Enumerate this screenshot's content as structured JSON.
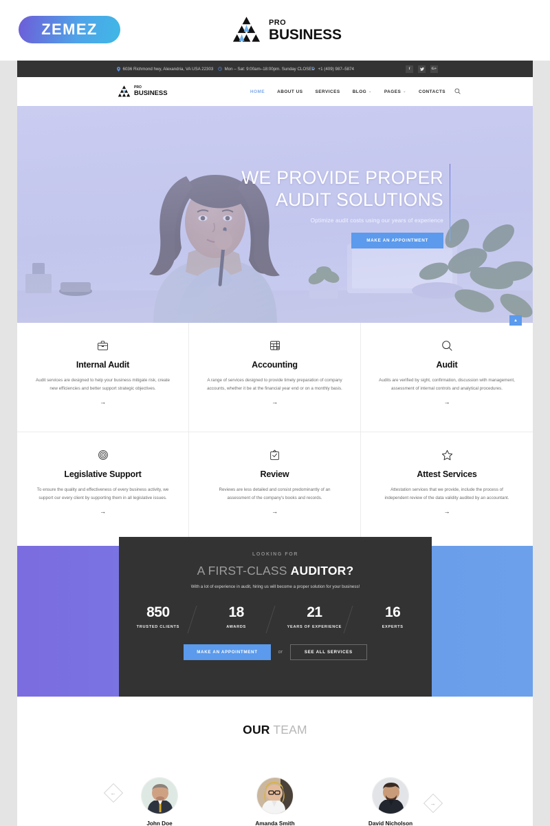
{
  "brand_strip": {
    "zemez_label": "ZEMEZ",
    "logo_pro": "PRO",
    "logo_business": "BUSINESS"
  },
  "colors": {
    "accent_blue": "#5b9aec",
    "nav_active": "#7fa9e8",
    "dark_panel": "#333333",
    "gradient_start": "#7b6ce0",
    "gradient_end": "#6ca0ea"
  },
  "topbar": {
    "address": "6036 Richmond hwy, Alexandria, VA USA 22303",
    "hours": "Mon – Sat: 9:00am–18:00pm. Sunday CLOSED",
    "phone": "+1 (409) 987–5874",
    "address_icon": "map-pin-icon",
    "hours_icon": "clock-icon",
    "phone_icon": "phone-icon",
    "social": [
      {
        "name": "facebook",
        "glyph": "f"
      },
      {
        "name": "twitter",
        "glyph": "ᴠ"
      },
      {
        "name": "google-plus",
        "glyph": "G+"
      }
    ]
  },
  "nav": {
    "logo_pro": "PRO",
    "logo_business": "BUSINESS",
    "items": [
      {
        "label": "HOME",
        "active": true,
        "caret": ""
      },
      {
        "label": "ABOUT US",
        "active": false,
        "caret": ""
      },
      {
        "label": "SERVICES",
        "active": false,
        "caret": ""
      },
      {
        "label": "BLOG",
        "active": false,
        "caret": "⌄"
      },
      {
        "label": "PAGES",
        "active": false,
        "caret": "⌄"
      },
      {
        "label": "CONTACTS",
        "active": false,
        "caret": ""
      }
    ],
    "search_icon": "search-icon"
  },
  "hero": {
    "title_line1": "WE PROVIDE PROPER",
    "title_line2": "AUDIT SOLUTIONS",
    "subtitle": "Optimize audit costs using our years of experience",
    "button_label": "MAKE AN APPOINTMENT"
  },
  "services": [
    {
      "icon": "briefcase-icon",
      "title": "Internal Audit",
      "text": "Audit services are designed to help your business mitigate risk, create new efficiencies and better support strategic objectives.",
      "arrow": "→"
    },
    {
      "icon": "spreadsheet-icon",
      "title": "Accounting",
      "text": "A range of services designed to provide timely preparation of company accounts, whether it be at the financial year end or on a monthly basis.",
      "arrow": "→"
    },
    {
      "icon": "magnifier-icon",
      "title": "Audit",
      "text": "Audits are verified by sight, confirmation, discussion with management, assessment of internal controls and analytical procedures.",
      "arrow": "→"
    },
    {
      "icon": "lifebuoy-icon",
      "title": "Legislative Support",
      "text": "To ensure the quality and effectiveness of every business activity, we support our every client by supporting them in all legislative issues.",
      "arrow": "→"
    },
    {
      "icon": "clipboard-check-icon",
      "title": "Review",
      "text": "Reviews are less detailed and consist predominantly of an assessment of the company's books and records.",
      "arrow": "→"
    },
    {
      "icon": "star-icon",
      "title": "Attest Services",
      "text": "Attestation services that we provide, include the process of independent review of the data validity audited by an accountant.",
      "arrow": "→"
    }
  ],
  "scroll_top": {
    "icon": "chevron-up-icon"
  },
  "cta": {
    "eyebrow": "LOOKING FOR",
    "heading_light": "A FIRST-CLASS",
    "heading_bold": "AUDITOR?",
    "subtitle": "With a lot of experience in audit, hiring us will become a proper solution for your business!",
    "counters": [
      {
        "value": "850",
        "label": "TRUSTED CLIENTS"
      },
      {
        "value": "18",
        "label": "AWARDS"
      },
      {
        "value": "21",
        "label": "YEARS OF EXPERIENCE"
      },
      {
        "value": "16",
        "label": "EXPERTS"
      }
    ],
    "primary_button": "MAKE AN APPOINTMENT",
    "separator": "or",
    "secondary_button": "SEE ALL SERVICES"
  },
  "team": {
    "heading_bold": "OUR",
    "heading_light": "TEAM",
    "members": [
      {
        "name": "John Doe"
      },
      {
        "name": "Amanda Smith"
      },
      {
        "name": "David Nicholson"
      }
    ],
    "prev_arrow": "←",
    "next_arrow": "→"
  }
}
